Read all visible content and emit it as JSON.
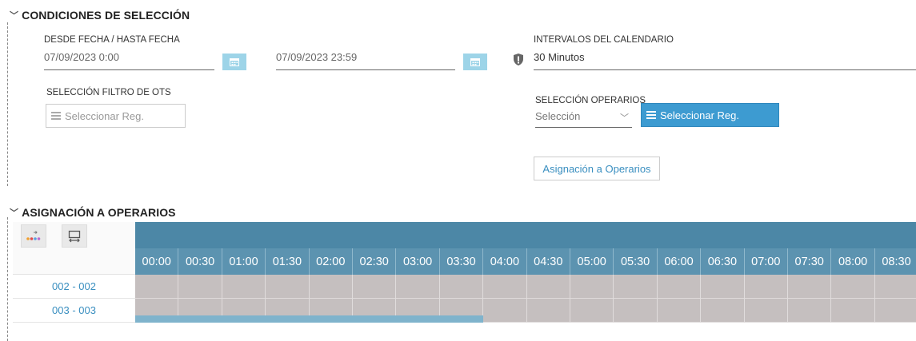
{
  "conditions": {
    "title": "CONDICIONES DE SELECCIÓN",
    "date_label": "DESDE FECHA / HASTA FECHA",
    "date_from": "07/09/2023 0:00",
    "date_to": "07/09/2023 23:59",
    "interval_label": "INTERVALOS DEL CALENDARIO",
    "interval_value": "30 Minutos",
    "ot_filter_label": "SELECCIÓN FILTRO DE OTS",
    "ot_filter_placeholder": "Seleccionar Reg.",
    "operators_label": "SELECCIÓN OPERARIOS",
    "operators_select": "Selección",
    "operators_button": "Seleccionar Reg.",
    "assign_button": "Asignación a Operarios"
  },
  "assignment": {
    "title": "ASIGNACIÓN A OPERARIOS",
    "times": [
      "00:00",
      "00:30",
      "01:00",
      "01:30",
      "02:00",
      "02:30",
      "03:00",
      "03:30",
      "04:00",
      "04:30",
      "05:00",
      "05:30",
      "06:00",
      "06:30",
      "07:00",
      "07:30",
      "08:00",
      "08:30"
    ],
    "rows": [
      {
        "label": "002 - 002"
      },
      {
        "label": "003 - 003"
      }
    ],
    "assigned_bar": {
      "row": 1,
      "from": "00:00",
      "to": "04:00"
    }
  },
  "colors": {
    "header_dark": "#4c87a6",
    "header_time": "#5c93b0",
    "cell_gray": "#c5bfbf",
    "bar_blue": "#7fb3cc",
    "accent": "#3d9bd1"
  }
}
